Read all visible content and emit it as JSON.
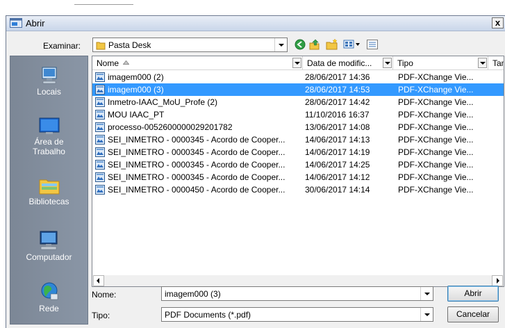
{
  "dialog": {
    "title": "Abrir",
    "close_label": "x"
  },
  "lookin": {
    "label": "Examinar:",
    "value": "Pasta Desk"
  },
  "places": [
    {
      "label": "Locais"
    },
    {
      "label": "Área de\nTrabalho"
    },
    {
      "label": "Bibliotecas"
    },
    {
      "label": "Computador"
    },
    {
      "label": "Rede"
    }
  ],
  "columns": [
    {
      "label": "Nome"
    },
    {
      "label": "Data de modific..."
    },
    {
      "label": "Tipo"
    },
    {
      "label": "Tam"
    }
  ],
  "files": [
    {
      "name": "imagem000 (2)",
      "date": "28/06/2017 14:36",
      "type": "PDF-XChange Vie...",
      "selected": false
    },
    {
      "name": "imagem000 (3)",
      "date": "28/06/2017 14:53",
      "type": "PDF-XChange Vie...",
      "selected": true
    },
    {
      "name": "Inmetro-IAAC_MoU_Profe (2)",
      "date": "28/06/2017 14:42",
      "type": "PDF-XChange Vie...",
      "selected": false
    },
    {
      "name": "MOU IAAC_PT",
      "date": "11/10/2016 16:37",
      "type": "PDF-XChange Vie...",
      "selected": false
    },
    {
      "name": "processo-0052600000029201782",
      "date": "13/06/2017 14:08",
      "type": "PDF-XChange Vie...",
      "selected": false
    },
    {
      "name": "SEI_INMETRO - 0000345 - Acordo de Cooper...",
      "date": "14/06/2017 14:13",
      "type": "PDF-XChange Vie...",
      "selected": false
    },
    {
      "name": "SEI_INMETRO - 0000345 - Acordo de Cooper...",
      "date": "14/06/2017 14:19",
      "type": "PDF-XChange Vie...",
      "selected": false
    },
    {
      "name": "SEI_INMETRO - 0000345 - Acordo de Cooper...",
      "date": "14/06/2017 14:25",
      "type": "PDF-XChange Vie...",
      "selected": false
    },
    {
      "name": "SEI_INMETRO - 0000345 - Acordo de Cooper...",
      "date": "14/06/2017 14:12",
      "type": "PDF-XChange Vie...",
      "selected": false
    },
    {
      "name": "SEI_INMETRO - 0000450 - Acordo de Cooper...",
      "date": "30/06/2017 14:14",
      "type": "PDF-XChange Vie...",
      "selected": false
    }
  ],
  "filename": {
    "label": "Nome:",
    "value": "imagem000 (3)"
  },
  "filetype": {
    "label": "Tipo:",
    "value": "PDF Documents (*.pdf)"
  },
  "buttons": {
    "open": "Abrir",
    "cancel": "Cancelar"
  },
  "colors": {
    "selection": "#3399ff",
    "places_bg": "#7c8796"
  }
}
